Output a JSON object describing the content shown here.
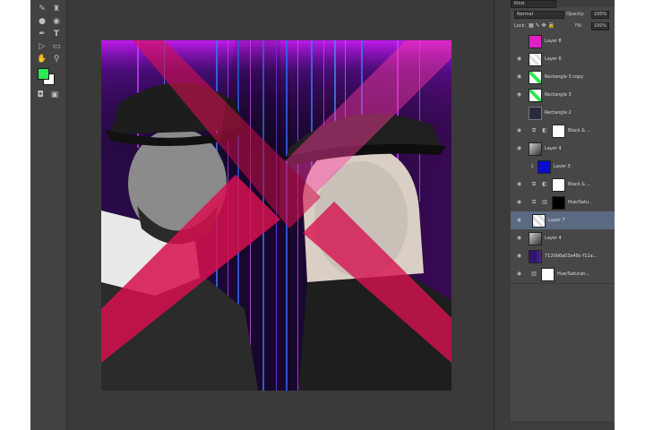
{
  "options": {
    "top_dropdown": "Kind",
    "blend_mode": "Normal",
    "opacity_label": "Opacity:",
    "opacity_value": "100%",
    "lock_label": "Lock:",
    "fill_label": "Fill:",
    "fill_value": "100%"
  },
  "colors": {
    "foreground": "#2ee852",
    "background": "#ffffff",
    "selected_layer": "#5b6a82"
  },
  "layers": [
    {
      "name": "Layer 8",
      "thumb": "magenta",
      "visible": false
    },
    {
      "name": "Layer 6",
      "thumb": "transparent",
      "visible": true
    },
    {
      "name": "Rectangle 3 copy",
      "thumb": "green-diagonal",
      "visible": true
    },
    {
      "name": "Rectangle 3",
      "thumb": "green-diagonal",
      "visible": true
    },
    {
      "name": "Rectangle 2",
      "thumb": "dark-outline",
      "visible": false
    },
    {
      "name": "Black & ...",
      "thumb": "adjustment",
      "mask": "white",
      "visible": true
    },
    {
      "name": "Layer 4",
      "thumb": "portrait",
      "visible": true
    },
    {
      "name": "Layer 3",
      "thumb": "blue",
      "visible": false
    },
    {
      "name": "Black & ...",
      "thumb": "adjustment",
      "mask": "white",
      "visible": true
    },
    {
      "name": "Hue/Satu...",
      "thumb": "adjustment",
      "mask": "black",
      "visible": true
    },
    {
      "name": "Layer 7",
      "thumb": "transparent",
      "visible": true,
      "selected": true
    },
    {
      "name": "Layer 4",
      "thumb": "portrait",
      "visible": true
    },
    {
      "name": "7120b6a03a48c-f11a...",
      "thumb": "matrix",
      "visible": true
    },
    {
      "name": "Hue/Saturati...",
      "thumb": "adjustment",
      "mask": "white",
      "visible": true
    }
  ]
}
